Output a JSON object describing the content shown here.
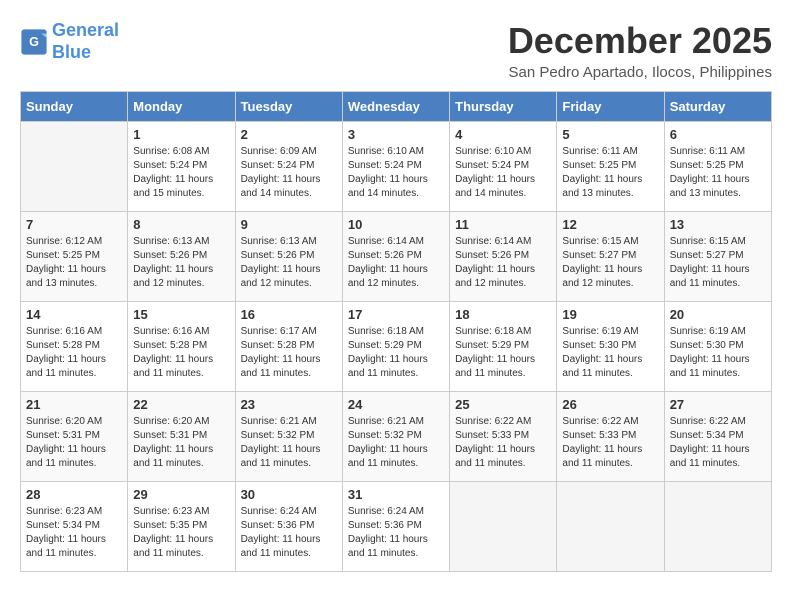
{
  "header": {
    "logo_line1": "General",
    "logo_line2": "Blue",
    "month": "December 2025",
    "location": "San Pedro Apartado, Ilocos, Philippines"
  },
  "weekdays": [
    "Sunday",
    "Monday",
    "Tuesday",
    "Wednesday",
    "Thursday",
    "Friday",
    "Saturday"
  ],
  "weeks": [
    [
      {
        "day": "",
        "info": ""
      },
      {
        "day": "1",
        "info": "Sunrise: 6:08 AM\nSunset: 5:24 PM\nDaylight: 11 hours\nand 15 minutes."
      },
      {
        "day": "2",
        "info": "Sunrise: 6:09 AM\nSunset: 5:24 PM\nDaylight: 11 hours\nand 14 minutes."
      },
      {
        "day": "3",
        "info": "Sunrise: 6:10 AM\nSunset: 5:24 PM\nDaylight: 11 hours\nand 14 minutes."
      },
      {
        "day": "4",
        "info": "Sunrise: 6:10 AM\nSunset: 5:24 PM\nDaylight: 11 hours\nand 14 minutes."
      },
      {
        "day": "5",
        "info": "Sunrise: 6:11 AM\nSunset: 5:25 PM\nDaylight: 11 hours\nand 13 minutes."
      },
      {
        "day": "6",
        "info": "Sunrise: 6:11 AM\nSunset: 5:25 PM\nDaylight: 11 hours\nand 13 minutes."
      }
    ],
    [
      {
        "day": "7",
        "info": "Sunrise: 6:12 AM\nSunset: 5:25 PM\nDaylight: 11 hours\nand 13 minutes."
      },
      {
        "day": "8",
        "info": "Sunrise: 6:13 AM\nSunset: 5:26 PM\nDaylight: 11 hours\nand 12 minutes."
      },
      {
        "day": "9",
        "info": "Sunrise: 6:13 AM\nSunset: 5:26 PM\nDaylight: 11 hours\nand 12 minutes."
      },
      {
        "day": "10",
        "info": "Sunrise: 6:14 AM\nSunset: 5:26 PM\nDaylight: 11 hours\nand 12 minutes."
      },
      {
        "day": "11",
        "info": "Sunrise: 6:14 AM\nSunset: 5:26 PM\nDaylight: 11 hours\nand 12 minutes."
      },
      {
        "day": "12",
        "info": "Sunrise: 6:15 AM\nSunset: 5:27 PM\nDaylight: 11 hours\nand 12 minutes."
      },
      {
        "day": "13",
        "info": "Sunrise: 6:15 AM\nSunset: 5:27 PM\nDaylight: 11 hours\nand 11 minutes."
      }
    ],
    [
      {
        "day": "14",
        "info": "Sunrise: 6:16 AM\nSunset: 5:28 PM\nDaylight: 11 hours\nand 11 minutes."
      },
      {
        "day": "15",
        "info": "Sunrise: 6:16 AM\nSunset: 5:28 PM\nDaylight: 11 hours\nand 11 minutes."
      },
      {
        "day": "16",
        "info": "Sunrise: 6:17 AM\nSunset: 5:28 PM\nDaylight: 11 hours\nand 11 minutes."
      },
      {
        "day": "17",
        "info": "Sunrise: 6:18 AM\nSunset: 5:29 PM\nDaylight: 11 hours\nand 11 minutes."
      },
      {
        "day": "18",
        "info": "Sunrise: 6:18 AM\nSunset: 5:29 PM\nDaylight: 11 hours\nand 11 minutes."
      },
      {
        "day": "19",
        "info": "Sunrise: 6:19 AM\nSunset: 5:30 PM\nDaylight: 11 hours\nand 11 minutes."
      },
      {
        "day": "20",
        "info": "Sunrise: 6:19 AM\nSunset: 5:30 PM\nDaylight: 11 hours\nand 11 minutes."
      }
    ],
    [
      {
        "day": "21",
        "info": "Sunrise: 6:20 AM\nSunset: 5:31 PM\nDaylight: 11 hours\nand 11 minutes."
      },
      {
        "day": "22",
        "info": "Sunrise: 6:20 AM\nSunset: 5:31 PM\nDaylight: 11 hours\nand 11 minutes."
      },
      {
        "day": "23",
        "info": "Sunrise: 6:21 AM\nSunset: 5:32 PM\nDaylight: 11 hours\nand 11 minutes."
      },
      {
        "day": "24",
        "info": "Sunrise: 6:21 AM\nSunset: 5:32 PM\nDaylight: 11 hours\nand 11 minutes."
      },
      {
        "day": "25",
        "info": "Sunrise: 6:22 AM\nSunset: 5:33 PM\nDaylight: 11 hours\nand 11 minutes."
      },
      {
        "day": "26",
        "info": "Sunrise: 6:22 AM\nSunset: 5:33 PM\nDaylight: 11 hours\nand 11 minutes."
      },
      {
        "day": "27",
        "info": "Sunrise: 6:22 AM\nSunset: 5:34 PM\nDaylight: 11 hours\nand 11 minutes."
      }
    ],
    [
      {
        "day": "28",
        "info": "Sunrise: 6:23 AM\nSunset: 5:34 PM\nDaylight: 11 hours\nand 11 minutes."
      },
      {
        "day": "29",
        "info": "Sunrise: 6:23 AM\nSunset: 5:35 PM\nDaylight: 11 hours\nand 11 minutes."
      },
      {
        "day": "30",
        "info": "Sunrise: 6:24 AM\nSunset: 5:36 PM\nDaylight: 11 hours\nand 11 minutes."
      },
      {
        "day": "31",
        "info": "Sunrise: 6:24 AM\nSunset: 5:36 PM\nDaylight: 11 hours\nand 11 minutes."
      },
      {
        "day": "",
        "info": ""
      },
      {
        "day": "",
        "info": ""
      },
      {
        "day": "",
        "info": ""
      }
    ]
  ]
}
